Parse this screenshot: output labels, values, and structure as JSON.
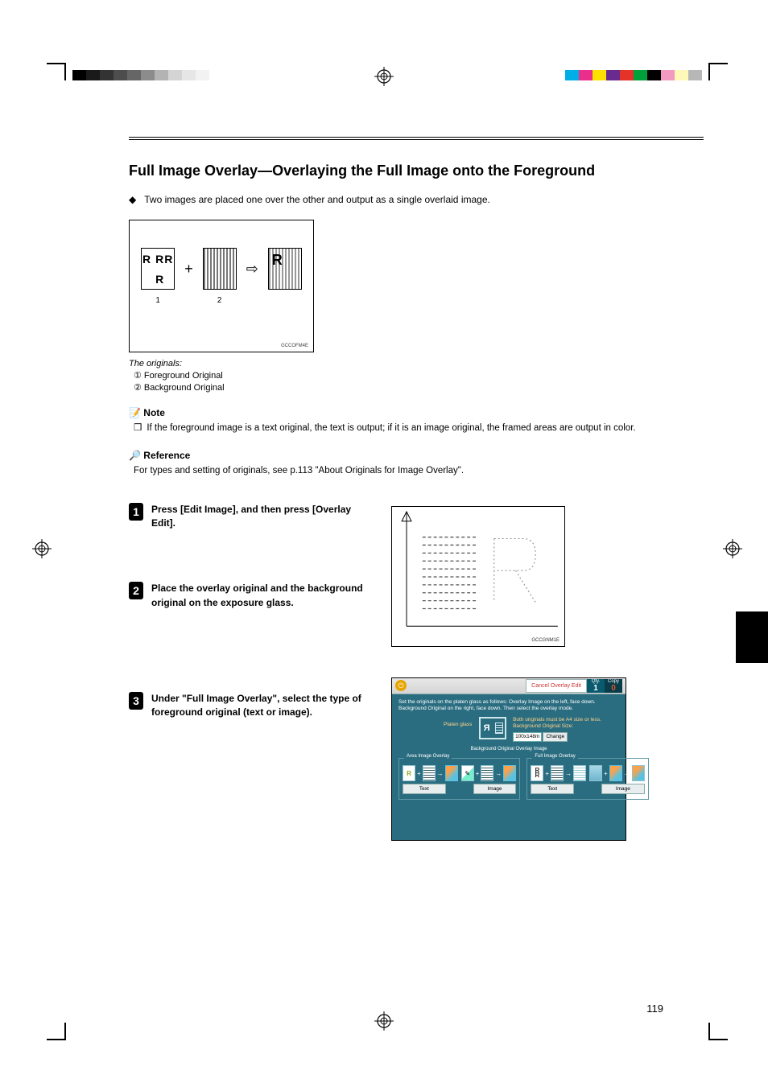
{
  "heading": "Full Image Overlay—Overlaying the Full Image onto the Foreground",
  "intro_bullet": "Two images are placed one over the other and output as a single overlaid image.",
  "figure1": {
    "rr_letter": "R",
    "num1": "1",
    "num2": "2",
    "caption_code": "GCCOFM4E",
    "label_heading": "The originals:",
    "label1": "Foreground Original",
    "label2": "Background Original"
  },
  "note": {
    "title": "Note",
    "item1": "If the foreground image is a text original, the text is output; if it is an image original, the framed areas are output in color."
  },
  "reference": {
    "title": "Reference",
    "item1": "For types and setting of originals, see",
    "link1": "p.113 \"About Originals for Image Overlay\"",
    "period": "."
  },
  "steps": {
    "s1": "Press [Edit Image], and then press [Overlay Edit].",
    "s2": "Place the overlay original and the background original on the exposure glass.",
    "s3": "Under \"Full Image Overlay\", select the type of foreground original (text or image)."
  },
  "platen_caption": "GCCGNM1E",
  "ui": {
    "cancel_label": "Cancel Overlay Edit",
    "qty_label": "Qty.",
    "qty_value": "1",
    "copy_label": "Copy",
    "copy_value": "0",
    "instr_line1": "Set the originals on the platen glass as follows: Overlay Image on the left, face down.",
    "instr_line2": "Background Original on the right, face down. Then select the overlay mode.",
    "platen_label": "Platen glass",
    "right_info_line1": "Both originals must be A4 size or less.",
    "right_info_line2": "Background Original Size:",
    "size_value": "100x148m",
    "change_label": "Change",
    "below_labels": "Background Original   Overlay Image",
    "group_area_title": "Area Image Overlay",
    "group_full_title": "Full Image Overlay",
    "btn_text": "Text",
    "btn_image": "Image"
  },
  "page_number": "119"
}
